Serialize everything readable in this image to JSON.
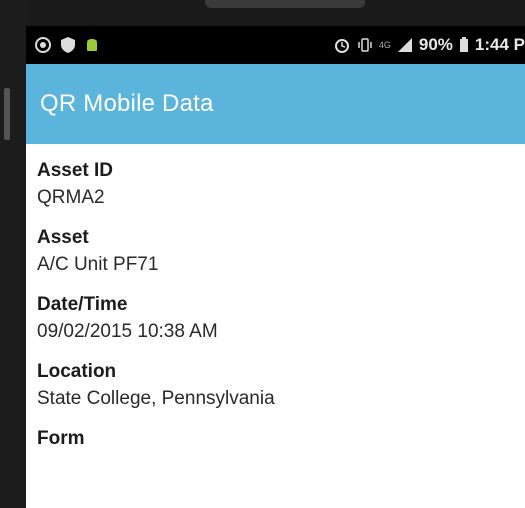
{
  "status_bar": {
    "left_icons": [
      "sim-icon",
      "shield-icon",
      "android-icon"
    ],
    "right_icons": [
      "alarm-icon",
      "vibrate-icon",
      "network-icon",
      "signal-icon"
    ],
    "network_text": "4G",
    "battery_percent": "90%",
    "battery_icon": "battery-icon",
    "time": "1:44 P"
  },
  "app_bar": {
    "title": "QR Mobile Data",
    "color": "#5ab4dc"
  },
  "fields": [
    {
      "label": "Asset ID",
      "value": "QRMA2"
    },
    {
      "label": "Asset",
      "value": "A/C Unit PF71"
    },
    {
      "label": "Date/Time",
      "value": "09/02/2015 10:38 AM"
    },
    {
      "label": "Location",
      "value": "State College, Pennsylvania"
    },
    {
      "label": "Form",
      "value": ""
    }
  ]
}
